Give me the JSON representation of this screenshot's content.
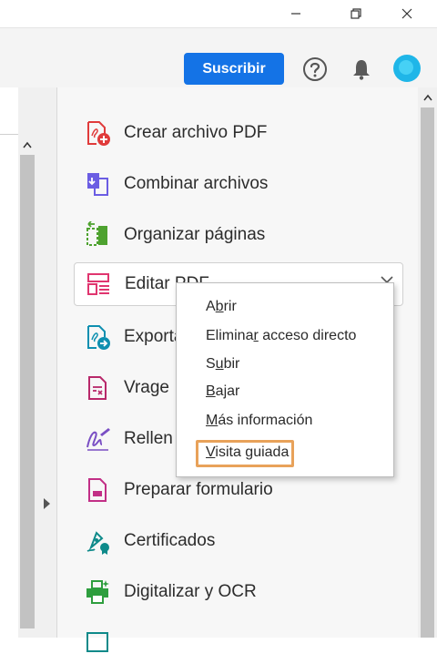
{
  "window": {
    "controls": [
      "minimize-icon",
      "restore-icon",
      "close-icon"
    ]
  },
  "toolbar": {
    "subscribe_label": "Suscribir",
    "icons": [
      "help-icon",
      "bell-icon",
      "avatar"
    ],
    "avatar_color": "#1fb6e8",
    "accent_color": "#1473e6"
  },
  "tools": [
    {
      "label": "Crear archivo PDF",
      "icon": "create-pdf-icon",
      "color": "#e03b3b"
    },
    {
      "label": "Combinar archivos",
      "icon": "combine-files-icon",
      "color": "#6b5de3"
    },
    {
      "label": "Organizar páginas",
      "icon": "organize-pages-icon",
      "color": "#4ea22f"
    },
    {
      "label": "Editar PDF",
      "icon": "edit-pdf-icon",
      "color": "#e0356f",
      "active": true
    },
    {
      "label": "Exporta",
      "icon": "export-pdf-icon",
      "color": "#0e8fb0"
    },
    {
      "label": "Vrage",
      "icon": "forms-icon",
      "color": "#b8286a"
    },
    {
      "label": "Rellen",
      "icon": "fill-sign-icon",
      "color": "#7a4fc4"
    },
    {
      "label": "Preparar formulario",
      "icon": "prepare-form-icon",
      "color": "#c22f86"
    },
    {
      "label": "Certificados",
      "icon": "certificates-icon",
      "color": "#0e8a8a"
    },
    {
      "label": "Digitalizar y OCR",
      "icon": "scan-ocr-icon",
      "color": "#2e9e3e"
    }
  ],
  "context_menu": {
    "items": [
      {
        "pre": "A",
        "ul": "b",
        "post": "rir"
      },
      {
        "pre": "Elimina",
        "ul": "r",
        "post": " acceso directo"
      },
      {
        "pre": "S",
        "ul": "u",
        "post": "bir"
      },
      {
        "pre": "",
        "ul": "B",
        "post": "ajar"
      },
      {
        "pre": "",
        "ul": "M",
        "post": "ás información"
      },
      {
        "pre": "",
        "ul": "V",
        "post": "isita guiada"
      }
    ],
    "highlighted_index": 5,
    "highlight_color": "#e8a25a"
  }
}
